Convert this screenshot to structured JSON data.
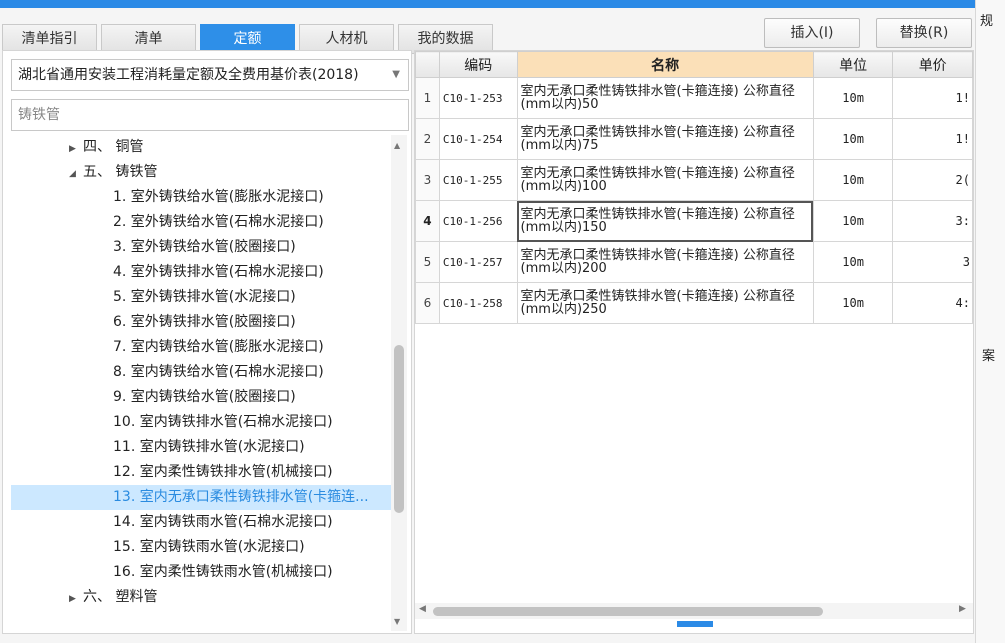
{
  "tabs": [
    "清单指引",
    "清单",
    "定额",
    "人材机",
    "我的数据"
  ],
  "active_tab": 2,
  "buttons": {
    "insert": "插入(I)",
    "replace": "替换(R)"
  },
  "library_select": "湖北省通用安装工程消耗量定额及全费用基价表(2018)",
  "search_value": "铸铁管",
  "tree": [
    {
      "arrow": "▶",
      "label": "四、 铜管",
      "indent": 1
    },
    {
      "arrow": "◢",
      "label": "五、 铸铁管",
      "indent": 1
    },
    {
      "arrow": "",
      "label": "1. 室外铸铁给水管(膨胀水泥接口)",
      "indent": 2
    },
    {
      "arrow": "",
      "label": "2. 室外铸铁给水管(石棉水泥接口)",
      "indent": 2
    },
    {
      "arrow": "",
      "label": "3. 室外铸铁给水管(胶圈接口)",
      "indent": 2
    },
    {
      "arrow": "",
      "label": "4. 室外铸铁排水管(石棉水泥接口)",
      "indent": 2
    },
    {
      "arrow": "",
      "label": "5. 室外铸铁排水管(水泥接口)",
      "indent": 2
    },
    {
      "arrow": "",
      "label": "6. 室外铸铁排水管(胶圈接口)",
      "indent": 2
    },
    {
      "arrow": "",
      "label": "7. 室内铸铁给水管(膨胀水泥接口)",
      "indent": 2
    },
    {
      "arrow": "",
      "label": "8. 室内铸铁给水管(石棉水泥接口)",
      "indent": 2
    },
    {
      "arrow": "",
      "label": "9. 室内铸铁给水管(胶圈接口)",
      "indent": 2
    },
    {
      "arrow": "",
      "label": "10. 室内铸铁排水管(石棉水泥接口)",
      "indent": 2
    },
    {
      "arrow": "",
      "label": "11. 室内铸铁排水管(水泥接口)",
      "indent": 2
    },
    {
      "arrow": "",
      "label": "12. 室内柔性铸铁排水管(机械接口)",
      "indent": 2
    },
    {
      "arrow": "",
      "label": "13. 室内无承口柔性铸铁排水管(卡箍连...",
      "indent": 2,
      "selected": true
    },
    {
      "arrow": "",
      "label": "14. 室内铸铁雨水管(石棉水泥接口)",
      "indent": 2
    },
    {
      "arrow": "",
      "label": "15. 室内铸铁雨水管(水泥接口)",
      "indent": 2
    },
    {
      "arrow": "",
      "label": "16. 室内柔性铸铁雨水管(机械接口)",
      "indent": 2
    },
    {
      "arrow": "▶",
      "label": "六、 塑料管",
      "indent": 1
    }
  ],
  "table": {
    "headers": [
      "",
      "编码",
      "名称",
      "单位",
      "单价"
    ],
    "rows": [
      {
        "idx": "1",
        "code": "C10-1-253",
        "name": "室内无承口柔性铸铁排水管(卡箍连接) 公称直径 (mm以内)50",
        "unit": "10m",
        "price": "1!"
      },
      {
        "idx": "2",
        "code": "C10-1-254",
        "name": "室内无承口柔性铸铁排水管(卡箍连接) 公称直径 (mm以内)75",
        "unit": "10m",
        "price": "1!"
      },
      {
        "idx": "3",
        "code": "C10-1-255",
        "name": "室内无承口柔性铸铁排水管(卡箍连接) 公称直径 (mm以内)100",
        "unit": "10m",
        "price": "2("
      },
      {
        "idx": "4",
        "code": "C10-1-256",
        "name": "室内无承口柔性铸铁排水管(卡箍连接) 公称直径 (mm以内)150",
        "unit": "10m",
        "price": "3:",
        "current": true
      },
      {
        "idx": "5",
        "code": "C10-1-257",
        "name": "室内无承口柔性铸铁排水管(卡箍连接) 公称直径 (mm以内)200",
        "unit": "10m",
        "price": "3"
      },
      {
        "idx": "6",
        "code": "C10-1-258",
        "name": "室内无承口柔性铸铁排水管(卡箍连接) 公称直径 (mm以内)250",
        "unit": "10m",
        "price": "4:"
      }
    ]
  },
  "right_strip": {
    "top_label": "规",
    "mid_label": "案"
  }
}
